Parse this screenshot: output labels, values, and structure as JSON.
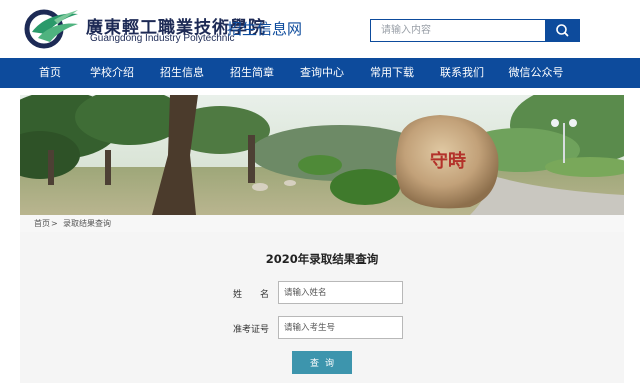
{
  "header": {
    "school_name_cn": "廣東輕工職業技術學院",
    "school_name_en": "Guangdong Industry Polytechnic",
    "site_title": "招生信息网"
  },
  "search": {
    "placeholder": "请输入内容",
    "button_icon": "search-icon"
  },
  "nav": {
    "items": [
      {
        "label": "首页"
      },
      {
        "label": "学校介绍"
      },
      {
        "label": "招生信息"
      },
      {
        "label": "招生简章"
      },
      {
        "label": "查询中心"
      },
      {
        "label": "常用下载"
      },
      {
        "label": "联系我们"
      },
      {
        "label": "微信公众号"
      }
    ]
  },
  "banner": {
    "stone_text": "守時"
  },
  "breadcrumb": {
    "home": "首页",
    "separator": ">",
    "current": "录取结果查询"
  },
  "form": {
    "title": "2020年录取结果查询",
    "name_label": "姓　　名",
    "name_placeholder": "请输入姓名",
    "id_label": "准考证号",
    "id_placeholder": "请输入考生号",
    "submit_label": "查询"
  },
  "colors": {
    "brand_blue": "#0d4b9c",
    "submit_teal": "#3d95ad",
    "panel_bg": "#f5f5f5"
  }
}
